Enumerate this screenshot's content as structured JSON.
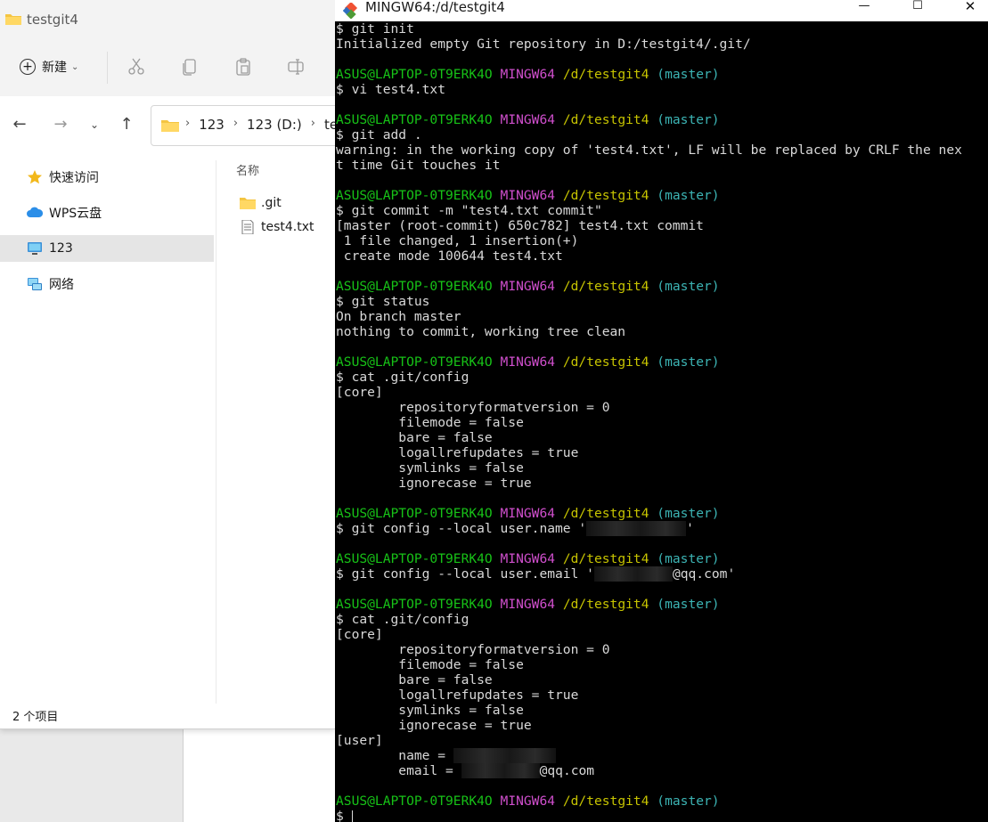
{
  "explorer": {
    "title": "testgit4",
    "toolbar": {
      "new_label": "新建"
    },
    "breadcrumb": [
      "123",
      "123 (D:)",
      "te"
    ],
    "sidebar": [
      {
        "label": "快速访问",
        "icon": "star-icon",
        "selected": false
      },
      {
        "label": "WPS云盘",
        "icon": "cloud-icon",
        "selected": false
      },
      {
        "label": "123",
        "icon": "computer-icon",
        "selected": true
      },
      {
        "label": "网络",
        "icon": "network-icon",
        "selected": false
      }
    ],
    "column_header": "名称",
    "files": [
      {
        "name": ".git",
        "icon": "folder-icon"
      },
      {
        "name": "test4.txt",
        "icon": "text-file-icon"
      }
    ],
    "status": "2 个项目"
  },
  "terminal": {
    "title": "MINGW64:/d/testgit4",
    "prompt": {
      "user": "ASUS@LAPTOP-0T9ERK4O",
      "env": "MINGW64",
      "path": "/d/testgit4",
      "branch": "(master)"
    },
    "colors": {
      "user": "#17c217",
      "env": "#d04fcd",
      "path": "#c7c400",
      "branch": "#3cb4b4",
      "text": "#d9d9d9",
      "background": "#000000"
    },
    "lines": {
      "l0": "$ git init",
      "l1": "Initialized empty Git repository in D:/testgit4/.git/",
      "l4": "$ vi test4.txt",
      "l7": "$ git add .",
      "l8": "warning: in the working copy of 'test4.txt', LF will be replaced by CRLF the nex",
      "l9": "t time Git touches it",
      "l12": "$ git commit -m \"test4.txt commit\"",
      "l13": "[master (root-commit) 650c782] test4.txt commit",
      "l14": " 1 file changed, 1 insertion(+)",
      "l15": " create mode 100644 test4.txt",
      "l18": "$ git status",
      "l19": "On branch master",
      "l20": "nothing to commit, working tree clean",
      "l23": "$ cat .git/config",
      "l24": "[core]",
      "l25": "        repositoryformatversion = 0",
      "l26": "        filemode = false",
      "l27": "        bare = false",
      "l28": "        logallrefupdates = true",
      "l29": "        symlinks = false",
      "l30": "        ignorecase = true",
      "l33a": "$ git config --local user.name '",
      "l33b": "'",
      "l36a": "$ git config --local user.email '",
      "l36b": "@qq.com'",
      "l39": "$ cat .git/config",
      "l40": "[core]",
      "l41": "        repositoryformatversion = 0",
      "l42": "        filemode = false",
      "l43": "        bare = false",
      "l44": "        logallrefupdates = true",
      "l45": "        symlinks = false",
      "l46": "        ignorecase = true",
      "l47": "[user]",
      "l48": "        name = ",
      "l49a": "        email = ",
      "l49b": "@qq.com",
      "l52": "$ "
    }
  }
}
